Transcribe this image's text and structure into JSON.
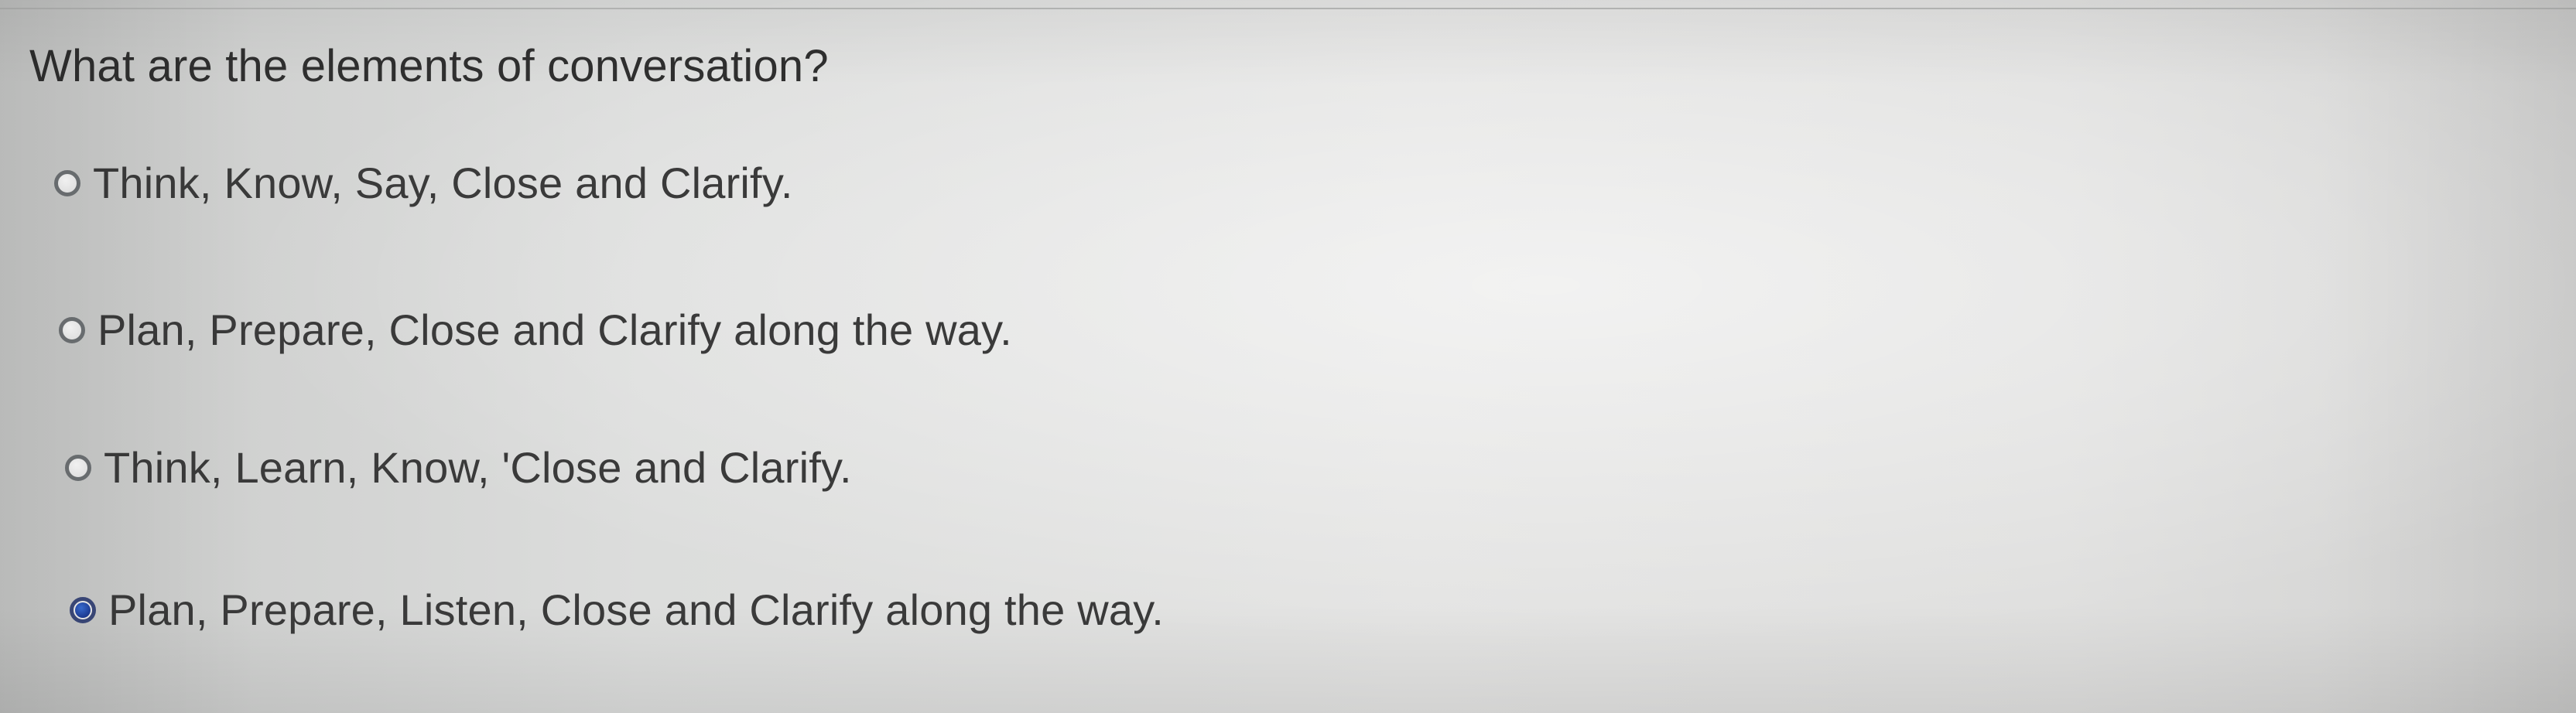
{
  "question": {
    "text": "What are the elements of conversation?"
  },
  "options": [
    {
      "label": "Think, Know, Say, Close and Clarify.",
      "selected": false
    },
    {
      "label": "Plan, Prepare, Close and Clarify along the way.",
      "selected": false
    },
    {
      "label": "Think, Learn, Know, 'Close and Clarify.",
      "selected": false
    },
    {
      "label": "Plan, Prepare, Listen, Close and Clarify along the way.",
      "selected": true
    }
  ],
  "colors": {
    "radio_selected": "#1f3e9a",
    "radio_border": "#6e7275",
    "text": "#3a3a3a"
  }
}
